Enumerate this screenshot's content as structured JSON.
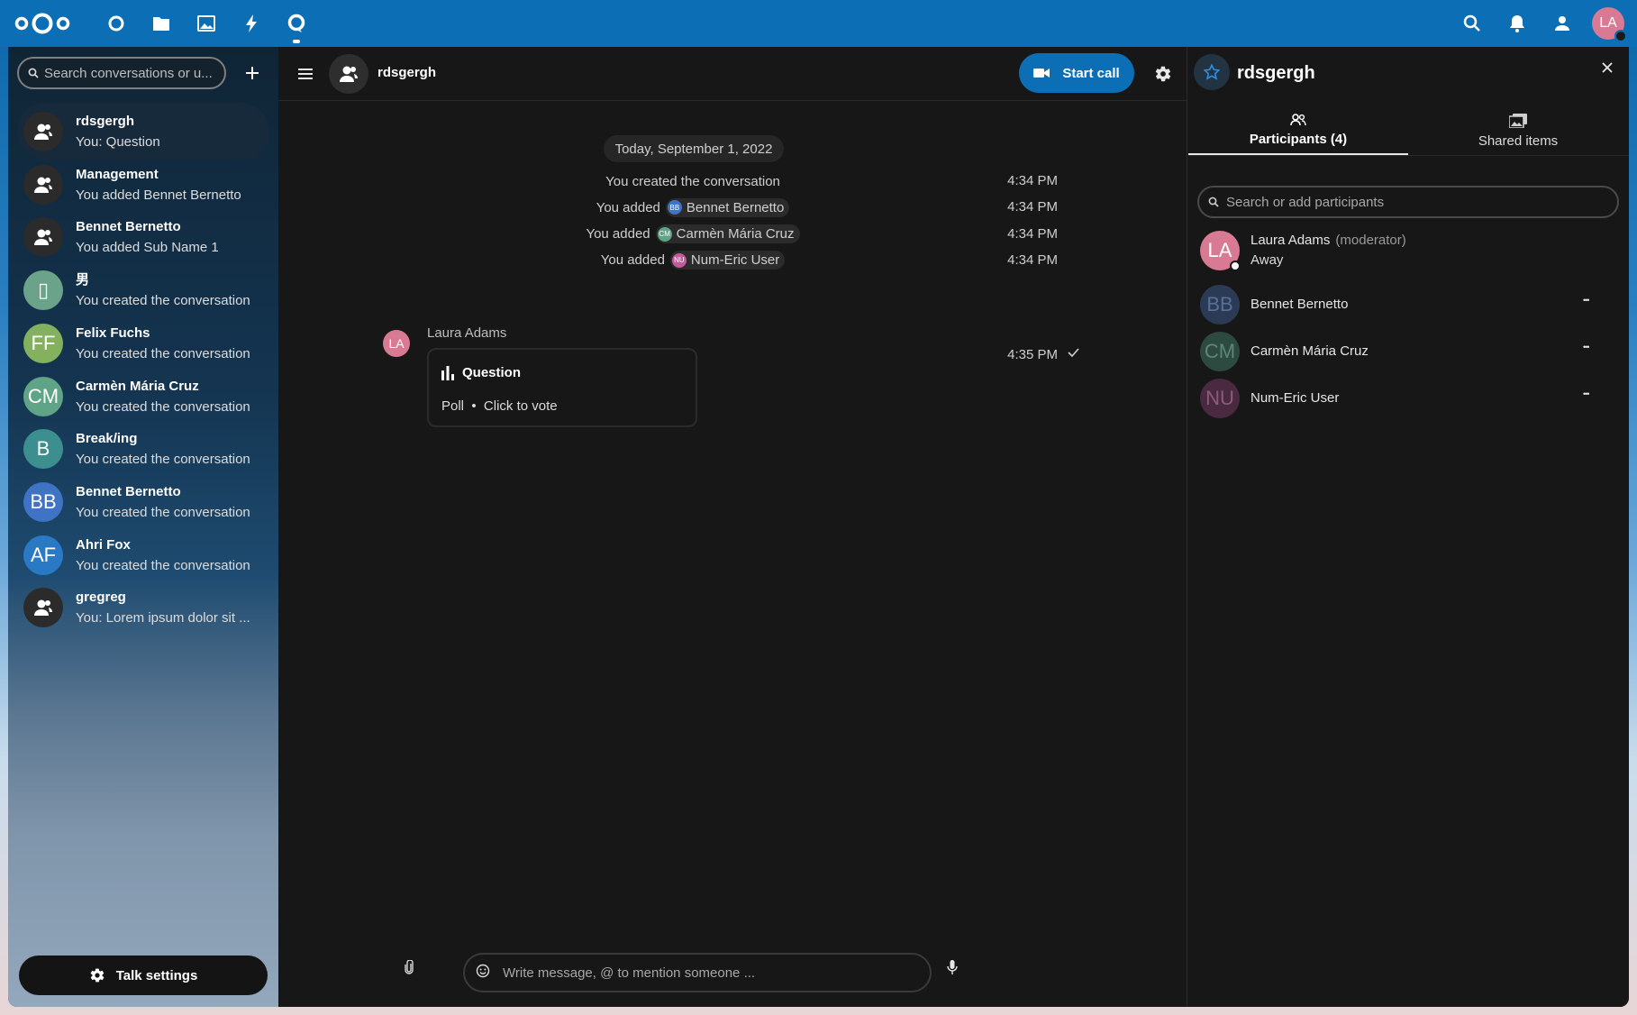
{
  "topbar": {
    "apps": [
      {
        "name": "dashboard-icon",
        "active": false
      },
      {
        "name": "files-icon",
        "active": false
      },
      {
        "name": "photos-icon",
        "active": false
      },
      {
        "name": "activity-icon",
        "active": false
      },
      {
        "name": "talk-icon",
        "active": true
      }
    ],
    "right_icons": [
      "search-icon",
      "notifications-icon",
      "contacts-icon"
    ],
    "user_initials": "LA"
  },
  "sidebar": {
    "search_placeholder": "Search conversations or u...",
    "conversations": [
      {
        "name": "rdsgergh",
        "subtitle": "You: Question",
        "avatar": "group",
        "active": true
      },
      {
        "name": "Management",
        "subtitle": "You added Bennet Bernetto",
        "avatar": "group"
      },
      {
        "name": "Bennet Bernetto",
        "subtitle": "You added Sub Name 1",
        "avatar": "group"
      },
      {
        "name": "男",
        "subtitle": "You created the conversation",
        "avatar_text": "▯",
        "avatar_color": "#6aa38a"
      },
      {
        "name": "Felix Fuchs",
        "subtitle": "You created the conversation",
        "avatar_text": "FF",
        "avatar_color": "#84b15e"
      },
      {
        "name": "Carmèn Mária Cruz",
        "subtitle": "You created the conversation",
        "avatar_text": "CM",
        "avatar_color": "#5fa486"
      },
      {
        "name": "Break/ing",
        "subtitle": "You created the conversation",
        "avatar_text": "B",
        "avatar_color": "#3d8f8f"
      },
      {
        "name": "Bennet Bernetto",
        "subtitle": "You created the conversation",
        "avatar_text": "BB",
        "avatar_color": "#3f73c4"
      },
      {
        "name": "Ahri Fox",
        "subtitle": "You created the conversation",
        "avatar_text": "AF",
        "avatar_color": "#2a79c4"
      },
      {
        "name": "gregreg",
        "subtitle": "You: Lorem ipsum dolor sit ...",
        "avatar": "group"
      }
    ],
    "talk_settings_label": "Talk settings"
  },
  "chat": {
    "title": "rdsgergh",
    "start_call_label": "Start call",
    "date": "Today, September 1, 2022",
    "system_messages": [
      {
        "prefix": "You created the conversation",
        "time": "4:34 PM"
      },
      {
        "prefix": "You added",
        "mention": "Bennet Bernetto",
        "mention_initials": "BB",
        "mention_color": "#3f73c4",
        "time": "4:34 PM"
      },
      {
        "prefix": "You added",
        "mention": "Carmèn Mária Cruz",
        "mention_initials": "CM",
        "mention_color": "#5fa486",
        "time": "4:34 PM"
      },
      {
        "prefix": "You added",
        "mention": "Num-Eric User",
        "mention_initials": "NU",
        "mention_color": "#c45a9a",
        "time": "4:34 PM"
      }
    ],
    "message": {
      "author": "Laura Adams",
      "author_initials": "LA",
      "poll_title": "Question",
      "poll_info": "Poll  •  Click to vote",
      "time": "4:35 PM"
    },
    "composer_placeholder": "Write message, @ to mention someone ..."
  },
  "right_panel": {
    "title": "rdsgergh",
    "tabs": [
      {
        "label": "Participants (4)",
        "active": true
      },
      {
        "label": "Shared items",
        "active": false
      }
    ],
    "search_placeholder": "Search or add participants",
    "participants": [
      {
        "initials": "LA",
        "name": "Laura Adams",
        "role": "(moderator)",
        "status": "Away",
        "color": "#d87a93",
        "text_color": "#ffffff"
      },
      {
        "initials": "BB",
        "name": "Bennet Bernetto",
        "color": "#2c3b55",
        "text_color": "#5a6f95"
      },
      {
        "initials": "CM",
        "name": "Carmèn Mária Cruz",
        "color": "#2d4a40",
        "text_color": "#5e8776"
      },
      {
        "initials": "NU",
        "name": "Num-Eric User",
        "color": "#4a2a40",
        "text_color": "#8e5a7e"
      }
    ]
  },
  "colors": {
    "brand": "#0c6fb5",
    "background": "#171717"
  }
}
